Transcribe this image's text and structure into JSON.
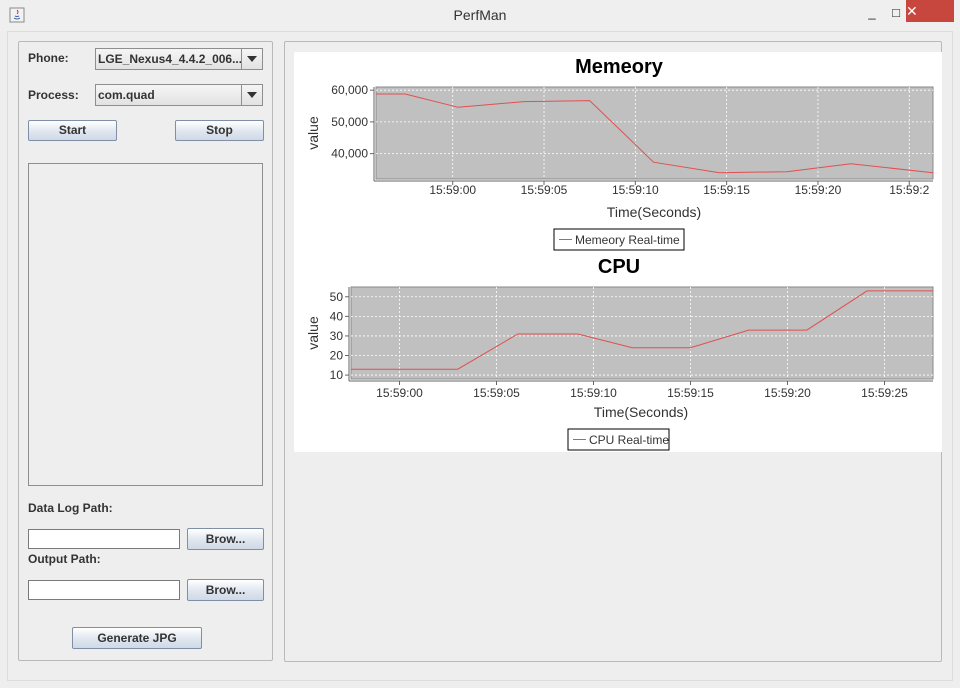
{
  "window": {
    "title": "PerfMan",
    "minimize": "_",
    "maximize": "□",
    "close": "✕"
  },
  "form": {
    "phone_label": "Phone:",
    "phone_value": "LGE_Nexus4_4.4.2_006...",
    "process_label": "Process:",
    "process_value": "com.quad",
    "start_label": "Start",
    "stop_label": "Stop",
    "data_log_label": "Data Log Path:",
    "data_log_value": "",
    "output_label": "Output Path:",
    "output_value": "",
    "browse_label": "Brow...",
    "generate_label": "Generate JPG"
  },
  "chart_data": [
    {
      "type": "line",
      "title": "Memeory",
      "xlabel": "Time(Seconds)",
      "ylabel": "value",
      "x_ticks": [
        "15:59:00",
        "15:59:05",
        "15:59:10",
        "15:59:15",
        "15:59:20",
        "15:59:2"
      ],
      "y_ticks": [
        "40,000",
        "50,000",
        "60,000"
      ],
      "xlim": [
        -4.2,
        26.3
      ],
      "ylim": [
        32000,
        61000
      ],
      "grid": true,
      "legend": "bottom-center",
      "series": [
        {
          "name": "Memeory Real-time",
          "color": "#e05050",
          "x": [
            -4.2,
            -2.6,
            0.3,
            3.9,
            7.5,
            11.0,
            14.6,
            18.3,
            21.8,
            26.3
          ],
          "y": [
            58800,
            58800,
            54600,
            56400,
            56700,
            37300,
            34000,
            34300,
            36800,
            34000
          ]
        }
      ]
    },
    {
      "type": "line",
      "title": "CPU",
      "xlabel": "Time(Seconds)",
      "ylabel": "value",
      "x_ticks": [
        "15:59:00",
        "15:59:05",
        "15:59:10",
        "15:59:15",
        "15:59:20",
        "15:59:25"
      ],
      "y_ticks": [
        "10",
        "20",
        "30",
        "40",
        "50"
      ],
      "xlim": [
        -2.5,
        27.5
      ],
      "ylim": [
        8,
        55
      ],
      "grid": true,
      "legend": "bottom-center",
      "series": [
        {
          "name": "CPU Real-time",
          "color": "#e05050",
          "x": [
            -2.5,
            3.0,
            6.1,
            9.2,
            12.0,
            15.0,
            18.0,
            21.0,
            24.1,
            27.5
          ],
          "y": [
            13,
            13,
            31,
            31,
            24,
            24,
            33,
            33,
            53,
            53
          ]
        }
      ]
    }
  ]
}
